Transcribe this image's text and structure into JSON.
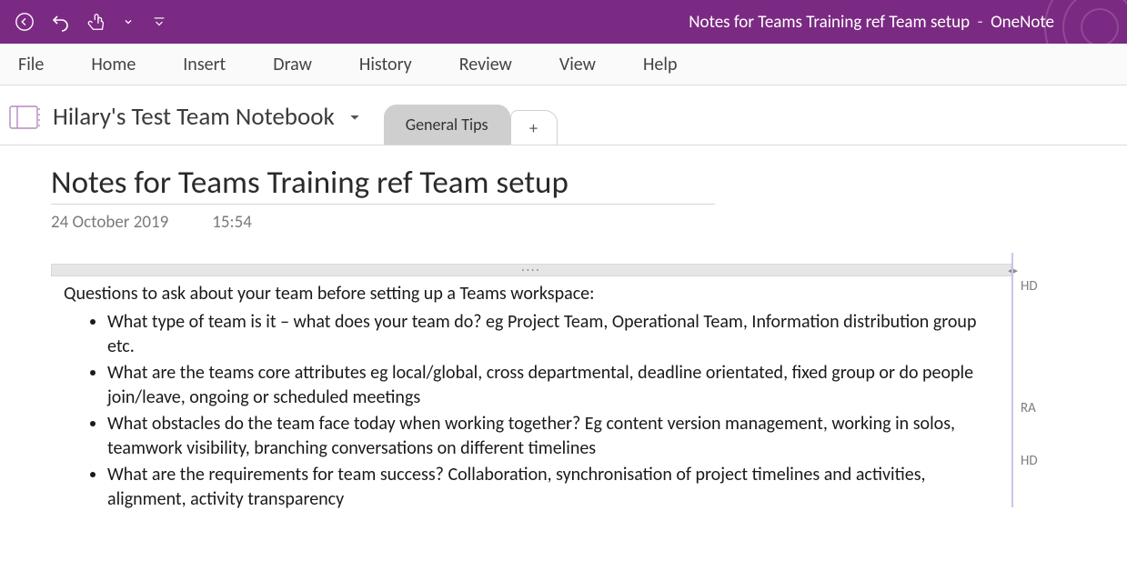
{
  "titlebar": {
    "doc_title": "Notes for Teams Training ref Team setup",
    "app_name": "OneNote"
  },
  "ribbon": {
    "file": "File",
    "home": "Home",
    "insert": "Insert",
    "draw": "Draw",
    "history": "History",
    "review": "Review",
    "view": "View",
    "help": "Help"
  },
  "notebook": {
    "name": "Hilary's Test Team Notebook",
    "section_active": "General Tips",
    "add_section_symbol": "+"
  },
  "page": {
    "title": "Notes for Teams Training ref Team setup",
    "date": "24 October 2019",
    "time": "15:54"
  },
  "content": {
    "intro": "Questions to ask about your team before setting up a Teams workspace:",
    "bullets": [
      "What type of team is it – what does your team do? eg Project Team, Operational Team, Information distribution group etc.",
      "What are the teams core attributes eg local/global, cross departmental, deadline orientated, fixed group or do people join/leave, ongoing or scheduled meetings",
      "What obstacles do the team face today when working together? Eg content version management, working in solos, teamwork visibility, branching conversations on different timelines",
      "What are the requirements for team success? Collaboration, synchronisation of project timelines and activities, alignment, activity transparency"
    ]
  },
  "authors": {
    "a0": "HD",
    "a1": "RA",
    "a2": "HD"
  }
}
